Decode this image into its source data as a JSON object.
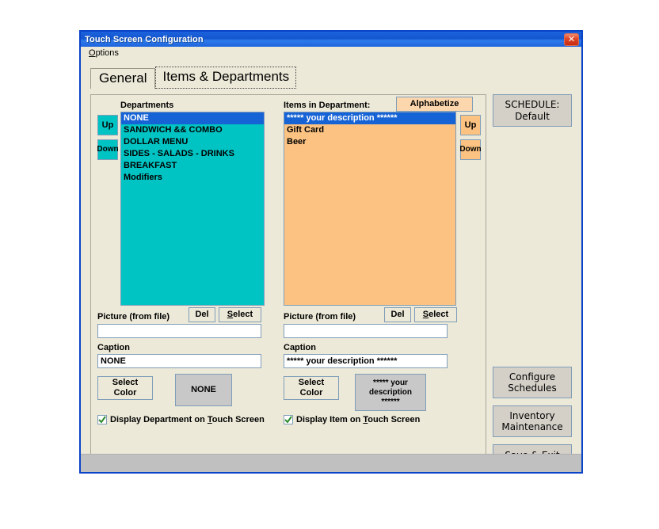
{
  "window": {
    "title": "Touch Screen Configuration",
    "close_label": "✕"
  },
  "menu": {
    "items": [
      {
        "label_before": "",
        "accel": "O",
        "label_after": "ptions"
      }
    ]
  },
  "tabs": [
    {
      "label": "General",
      "active": false
    },
    {
      "label": "Items & Departments",
      "active": true
    }
  ],
  "departments_panel": {
    "list_label": "Departments",
    "up_label": "Up",
    "down_label": "Down",
    "items": [
      {
        "label": "NONE",
        "selected": true
      },
      {
        "label": "SANDWICH && COMBO",
        "selected": false
      },
      {
        "label": "DOLLAR MENU",
        "selected": false
      },
      {
        "label": "SIDES - SALADS - DRINKS",
        "selected": false
      },
      {
        "label": "BREAKFAST",
        "selected": false
      },
      {
        "label": "Modifiers",
        "selected": false
      }
    ],
    "picture_label": "Picture (from file)",
    "del_label": "Del",
    "select_accel": "S",
    "select_rest": "elect",
    "picture_value": "",
    "caption_label": "Caption",
    "caption_value": "NONE",
    "select_color_label": "Select\nColor",
    "preview_text": "NONE",
    "preview_color": "#c8c8c8",
    "list_color": "#00c4c4",
    "checkbox": {
      "checked": true,
      "before": "Display Department on ",
      "accel": "T",
      "after": "ouch Screen"
    }
  },
  "items_panel": {
    "list_label": "Items in Department:",
    "alphabetize_label": "Alphabetize",
    "up_label": "Up",
    "down_label": "Down",
    "items": [
      {
        "label": "***** your description ******",
        "selected": true
      },
      {
        "label": "Gift Card",
        "selected": false
      },
      {
        "label": "Beer",
        "selected": false
      }
    ],
    "picture_label": "Picture (from file)",
    "del_label": "Del",
    "select_accel": "S",
    "select_rest": "elect",
    "picture_value": "",
    "caption_label": "Caption",
    "caption_value": "***** your description ******",
    "select_color_label": "Select\nColor",
    "preview_text": "*****  your\ndescription\n******",
    "preview_color": "#c8c8c8",
    "list_color": "#fcc281",
    "checkbox": {
      "checked": true,
      "before": "Display Item on ",
      "accel": "T",
      "after": "ouch Screen"
    }
  },
  "sidebar": {
    "schedule_label": "SCHEDULE:\nDefault",
    "configure_label": "Configure\nSchedules",
    "inventory_label": "Inventory\nMaintenance",
    "save_before": "Save & E",
    "save_accel": "x",
    "save_after": "it"
  },
  "colors": {
    "title_blue": "#1b63dd",
    "dialog_face": "#ece9d8",
    "teal": "#00c4c4",
    "peach": "#fcc281",
    "selection_blue": "#1663d6",
    "close_red": "#c62b10"
  }
}
